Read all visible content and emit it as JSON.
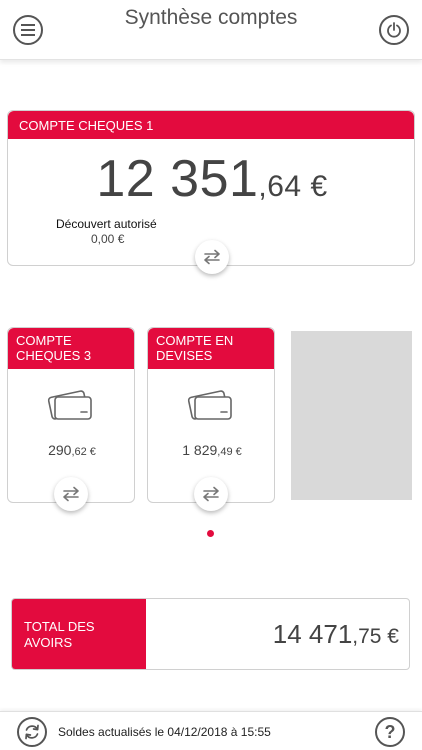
{
  "header": {
    "title": "Synthèse comptes",
    "menu_icon": "hamburger-menu-icon",
    "power_icon": "power-icon"
  },
  "main_account": {
    "name": "COMPTE CHEQUES 1",
    "balance_integer": "12 351",
    "balance_decimal": ",64 €",
    "overdraft_label": "Découvert autorisé",
    "overdraft_value": "0,00 €",
    "transfer_icon": "transfer-arrows-icon"
  },
  "accounts": [
    {
      "name_line1": "COMPTE",
      "name_line2": "CHEQUES 3",
      "balance_integer": "290",
      "balance_decimal": ",62 €",
      "icon": "card-icon"
    },
    {
      "name_line1": "COMPTE EN",
      "name_line2": "DEVISES",
      "balance_integer": "1 829",
      "balance_decimal": ",49 €",
      "icon": "card-icon"
    }
  ],
  "pagination": {
    "current": 1
  },
  "total": {
    "label_line1": "TOTAL DES",
    "label_line2": "AVOIRS",
    "amount_integer": "14 471",
    "amount_decimal": ",75 €"
  },
  "footer": {
    "status": "Soldes actualisés le 04/12/2018 à 15:55",
    "refresh_icon": "refresh-icon",
    "help_label": "?"
  },
  "colors": {
    "accent": "#e30b3e",
    "placeholder": "#d9d9d9",
    "text": "#444444"
  }
}
